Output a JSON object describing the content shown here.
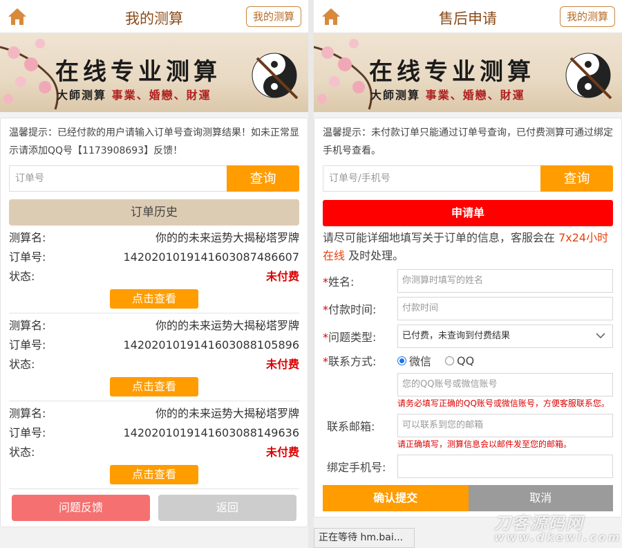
{
  "left": {
    "header": {
      "title": "我的测算",
      "my_button": "我的测算"
    },
    "banner": {
      "title": "在线专业测算",
      "sub_prefix": "大師测算",
      "sub_red": "事業、婚戀、財運"
    },
    "tip": "温馨提示：已经付款的用户请输入订单号查询测算结果！如未正常显示请添加QQ号【1173908693】反馈！",
    "search": {
      "placeholder": "订单号",
      "button": "查询"
    },
    "history_button": "订单历史",
    "orders": [
      {
        "name_label": "测算名:",
        "name": "你的的未来运势大揭秘塔罗牌",
        "no_label": "订单号:",
        "no": "14202010191416030874866​07",
        "status_label": "状态:",
        "status": "未付费",
        "view": "点击查看"
      },
      {
        "name_label": "测算名:",
        "name": "你的的未来运势大揭秘塔罗牌",
        "no_label": "订单号:",
        "no": "142020101914160308810589​6",
        "status_label": "状态:",
        "status": "未付费",
        "view": "点击查看"
      },
      {
        "name_label": "测算名:",
        "name": "你的的未来运势大揭秘塔罗牌",
        "no_label": "订单号:",
        "no": "14202010191416030881496​36",
        "status_label": "状态:",
        "status": "未付费",
        "view": "点击查看"
      }
    ],
    "feedback_button": "问题反馈",
    "back_button": "返回"
  },
  "right": {
    "header": {
      "title": "售后申请",
      "my_button": "我的测算"
    },
    "banner": {
      "title": "在线专业测算",
      "sub_prefix": "大師测算",
      "sub_red": "事業、婚戀、財運"
    },
    "tip": "温馨提示：未付款订单只能通过订单号查询，已付费测算可通过绑定手机号查看。",
    "search": {
      "placeholder": "订单号/手机号",
      "button": "查询"
    },
    "apply_bar": "申请单",
    "desc_pre": "请尽可能详细地填写关于订单的信息，客服会在 ",
    "desc_hl": "7x24小时在线",
    "desc_post": " 及时处理。",
    "form": {
      "name_label": "姓名:",
      "name_placeholder": "你测算时填写的姓名",
      "paytime_label": "付款时间:",
      "paytime_placeholder": "付款时间",
      "type_label": "问题类型:",
      "type_value": "已付费，未查询到付费结果",
      "contact_label": "联系方式:",
      "radio_wechat": "微信",
      "radio_qq": "QQ",
      "contact_placeholder": "您的QQ账号或微信账号",
      "contact_note": "请务必填写正确的QQ账号或微信账号，方便客服联系您。",
      "email_label": "联系邮箱:",
      "email_placeholder": "可以联系到您的邮箱",
      "email_note": "请正确填写，测算信息会以邮件发至您的邮箱。",
      "phone_label": "绑定手机号:"
    },
    "submit_button": "确认提交",
    "cancel_button": "取消"
  },
  "status_bar": "正在等待 hm.bai...",
  "watermark": {
    "line1": "刀客源码网",
    "line2": "www.dkewl.com"
  },
  "colors": {
    "accent": "#ff9c00",
    "red": "#ff0000",
    "brown": "#8a4a17"
  }
}
